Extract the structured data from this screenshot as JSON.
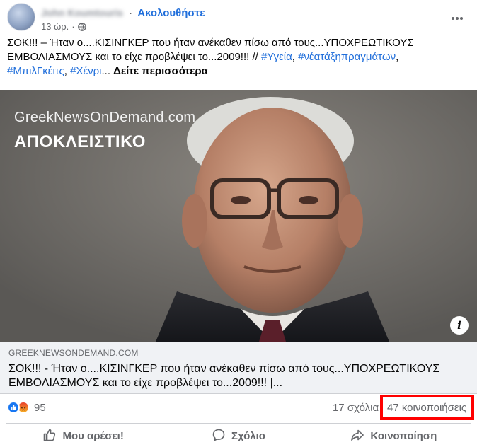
{
  "post": {
    "author_name": "John Koumtouris",
    "follow_label": "Ακολουθήστε",
    "time": "13 ώρ.",
    "caption": {
      "text_main": "ΣΟΚ!!! – Ήταν ο....ΚΙΣΙΝΓΚΕΡ που ήταν ανέκαθεν πίσω από τους...ΥΠΟΧΡΕΩΤΙΚΟΥΣ ΕΜΒΟΛΙΑΣΜΟΥΣ και το είχε προβλέψει το...2009!!! // ",
      "tags": [
        "#Υγεία",
        "#νέατάξηπραγμάτων",
        "#ΜπιλΓκέιτς",
        "#Χένρι"
      ],
      "sep": ", ",
      "ellipsis": "... ",
      "see_more": "Δείτε περισσότερα"
    },
    "image": {
      "watermark": "GreekNewsOnDemand.com",
      "headline": "ΑΠΟΚΛΕΙΣΤΙΚΟ",
      "info_label": "i"
    },
    "link": {
      "domain": "GREEKNEWSONDEMAND.COM",
      "title": "ΣΟΚ!!! - Ήταν ο....ΚΙΣΙΝΓΚΕΡ που ήταν ανέκαθεν πίσω από τους...ΥΠΟΧΡΕΩΤΙΚΟΥΣ ΕΜΒΟΛΙΑΣΜΟΥΣ και το είχε προβλέψει το...2009!!! |..."
    },
    "stats": {
      "reactions_count": "95",
      "comments": "17 σχόλια",
      "shares": "47 κοινοποιήσεις"
    },
    "actions": {
      "like": "Μου αρέσει!",
      "comment": "Σχόλιο",
      "share": "Κοινοποίηση"
    }
  },
  "colors": {
    "link_blue": "#216fdb",
    "highlight": "#ff0000",
    "muted": "#65676b"
  }
}
